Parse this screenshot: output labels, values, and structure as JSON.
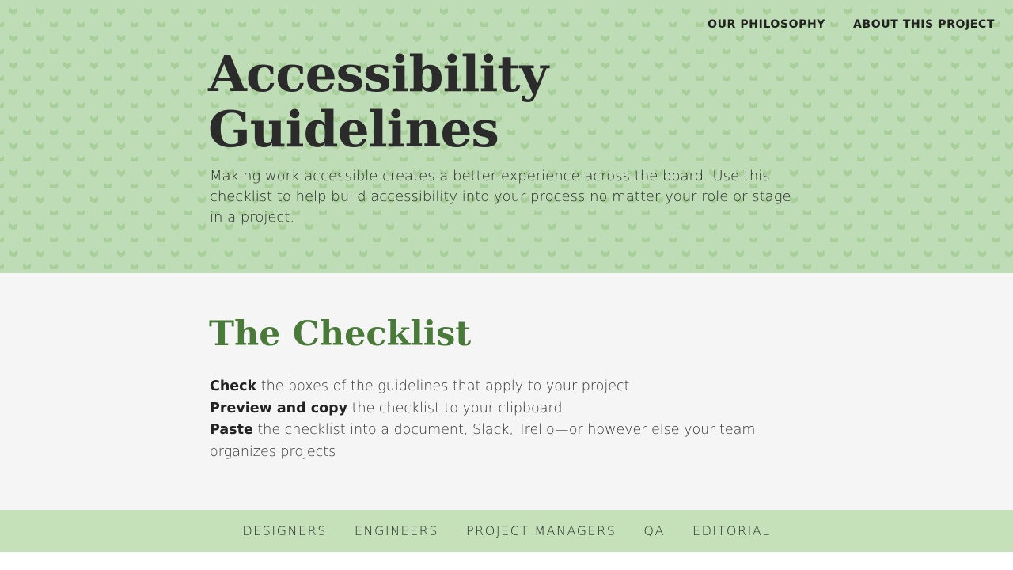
{
  "top_nav": {
    "items": [
      {
        "label": "OUR PHILOSOPHY"
      },
      {
        "label": "ABOUT THIS PROJECT"
      }
    ]
  },
  "hero": {
    "title_line1": "Accessibility",
    "title_line2": "Guidelines",
    "description": "Making work accessible creates a better experience across the board. Use this checklist to help build accessibility into your process no matter your role or stage in a project."
  },
  "checklist": {
    "title": "The Checklist",
    "steps": [
      {
        "bold": "Check",
        "rest": " the boxes of the guidelines that apply to your project"
      },
      {
        "bold": "Preview and copy",
        "rest": " the checklist to your clipboard"
      },
      {
        "bold": "Paste",
        "rest": " the checklist into a document, Slack, Trello—or however else your team organizes projects"
      }
    ]
  },
  "role_nav": {
    "items": [
      {
        "label": "DESIGNERS"
      },
      {
        "label": "ENGINEERS"
      },
      {
        "label": "PROJECT MANAGERS"
      },
      {
        "label": "QA"
      },
      {
        "label": "EDITORIAL"
      }
    ]
  },
  "colors": {
    "hero_bg": "#bedcb5",
    "pattern": "#a7cc98",
    "accent_green": "#4a7a3a",
    "role_nav_bg": "#c5e1b9"
  }
}
